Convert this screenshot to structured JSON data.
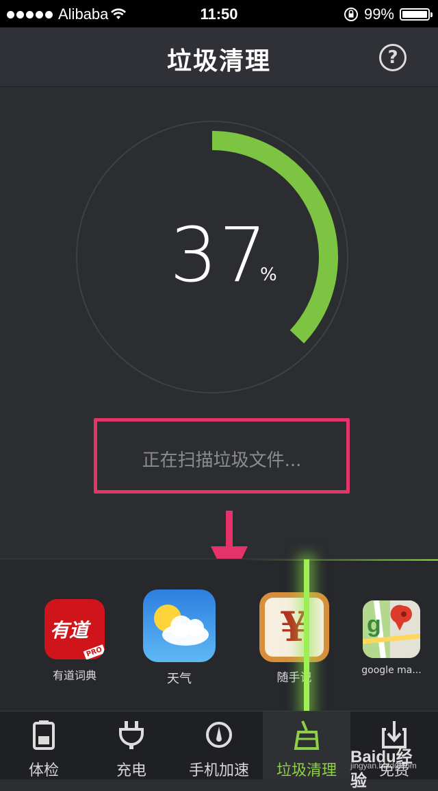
{
  "status_bar": {
    "carrier": "Alibaba",
    "time": "11:50",
    "battery": "99%",
    "battery_level": 0.99
  },
  "header": {
    "title": "垃圾清理",
    "help_label": "?"
  },
  "gauge": {
    "percent": "37",
    "percent_sign": "%",
    "progress": 0.37,
    "accent_color": "#7cc442"
  },
  "scan": {
    "status_text": "正在扫描垃圾文件..."
  },
  "apps": [
    {
      "name": "有道词典",
      "icon": "youdao-dict-icon",
      "icon_text": "有道",
      "badge": "PRO"
    },
    {
      "name": "天气",
      "icon": "weather-icon"
    },
    {
      "name": "随手记",
      "icon": "suishouji-icon",
      "icon_text": "¥"
    },
    {
      "name": "google ma...",
      "icon": "google-maps-icon"
    }
  ],
  "tabs": [
    {
      "label": "体检",
      "icon": "battery-icon"
    },
    {
      "label": "充电",
      "icon": "plug-icon"
    },
    {
      "label": "手机加速",
      "icon": "speedometer-icon"
    },
    {
      "label": "垃圾清理",
      "icon": "broom-icon",
      "active": true
    },
    {
      "label": "免费",
      "icon": "download-icon"
    }
  ],
  "watermark": {
    "text": "Baidu经验",
    "url": "jingyan.baidu.com"
  }
}
